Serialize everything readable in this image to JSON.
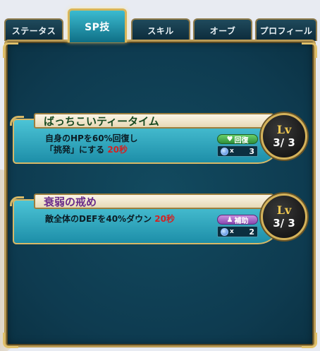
{
  "tabs": [
    {
      "label": "ステータス",
      "active": false
    },
    {
      "label": "SP技",
      "active": true
    },
    {
      "label": "スキル",
      "active": false
    },
    {
      "label": "オーブ",
      "active": false
    },
    {
      "label": "プロフィール",
      "active": false
    }
  ],
  "skills": [
    {
      "name": "ばっちこいティータイム",
      "desc_line1": "自身のHPを60%回復し",
      "desc_line2": "「挑発」にする",
      "duration": "20秒",
      "type_label": "回復",
      "type_icon": "heart-icon",
      "cost_x": "x",
      "cost": "3",
      "lv_label": "Lv",
      "lv_value": "3/ 3"
    },
    {
      "name": "衰弱の戒め",
      "desc_line1": "敵全体のDEFを40%ダウン",
      "duration": "20秒",
      "type_label": "補助",
      "type_icon": "person-icon",
      "cost_x": "x",
      "cost": "2",
      "lv_label": "Lv",
      "lv_value": "3/ 3"
    }
  ],
  "colors": {
    "panel": "#0e3b50",
    "gold": "#d7b866",
    "red_text": "#d32222"
  }
}
